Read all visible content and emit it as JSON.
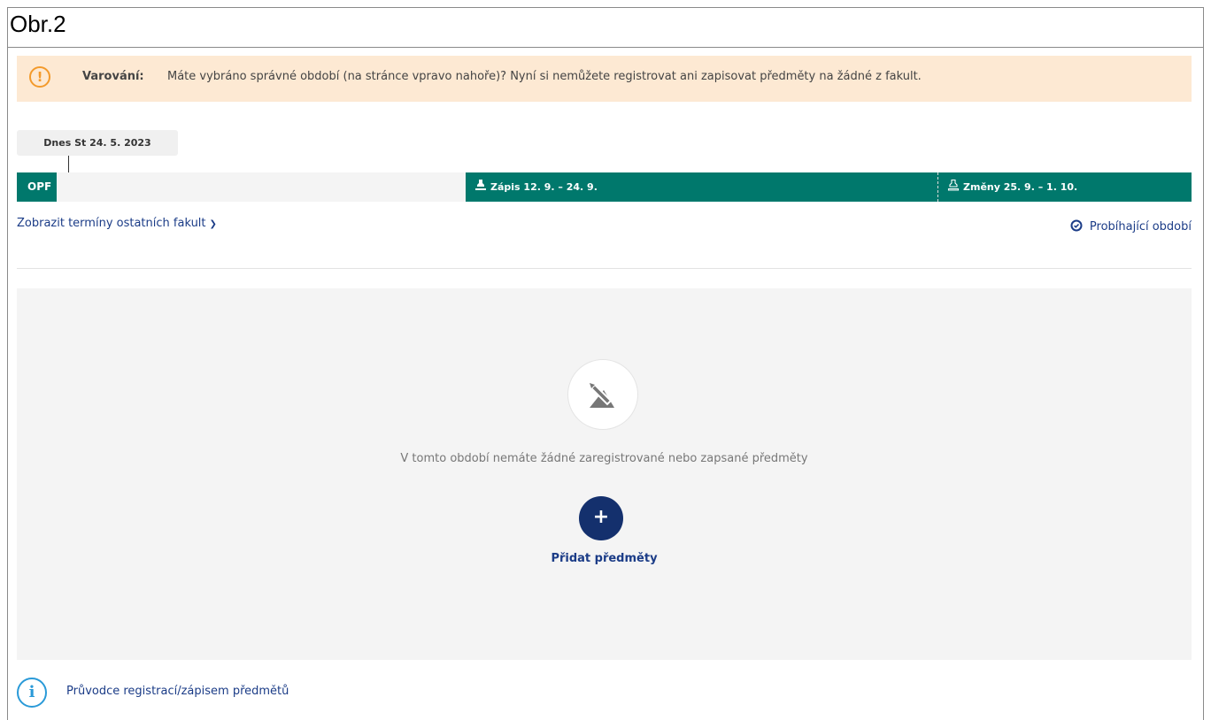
{
  "caption": "Obr.2",
  "warning": {
    "icon": "exclamation-icon",
    "label": "Varování:",
    "text": "Máte vybráno správné období (na stránce vpravo nahoře)? Nyní si nemůžete registrovat ani zapisovat předměty na žádné z fakult."
  },
  "today": "Dnes St 24. 5. 2023",
  "timeline": {
    "faculty": "OPF",
    "zapis": "Zápis 12. 9. – 24. 9.",
    "zmeny": "Změny 25. 9. – 1. 10."
  },
  "links": {
    "show_terms": "Zobrazit termíny ostatních fakult",
    "current_period": "Probíhající období"
  },
  "empty_state": {
    "message": "V tomto období nemáte žádné zaregistrované nebo zapsané předměty",
    "add_label": "Přidat předměty"
  },
  "guide": "Průvodce registrací/zápisem předmětů",
  "colors": {
    "accent_green": "#00786c",
    "navy": "#14306d",
    "warning_bg": "#fde9d3",
    "warning_icon": "#f39a2b",
    "info_blue": "#2a9ad8"
  }
}
